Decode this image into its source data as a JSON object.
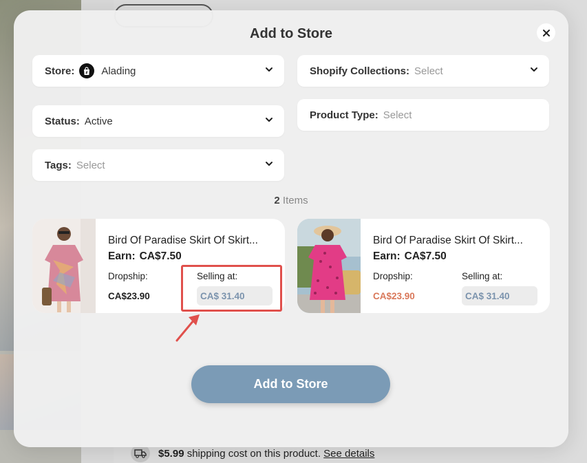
{
  "background": {
    "shipping": {
      "price": "$5.99",
      "text": " shipping cost on this product. ",
      "link": "See details"
    }
  },
  "modal": {
    "title": "Add to Store",
    "fields": {
      "store": {
        "label": "Store:",
        "value": "Alading"
      },
      "collections": {
        "label": "Shopify Collections:",
        "placeholder": "Select"
      },
      "status": {
        "label": "Status:",
        "value": "Active"
      },
      "product_type": {
        "label": "Product Type:",
        "placeholder": "Select"
      },
      "tags": {
        "label": "Tags:",
        "placeholder": "Select"
      }
    },
    "items": {
      "count": "2",
      "label": " Items"
    },
    "products": [
      {
        "title": "Bird Of Paradise Skirt Of Skirt...",
        "earn_label": "Earn:",
        "earn_value": "CA$7.50",
        "dropship_label": "Dropship:",
        "dropship_value": "CA$23.90",
        "dropship_color": "#222222",
        "selling_label": "Selling at:",
        "selling_value": "CA$ 31.40"
      },
      {
        "title": "Bird Of Paradise Skirt Of Skirt...",
        "earn_label": "Earn:",
        "earn_value": "CA$7.50",
        "dropship_label": "Dropship:",
        "dropship_value": "CA$23.90",
        "dropship_color": "#d9785a",
        "selling_label": "Selling at:",
        "selling_value": "CA$ 31.40"
      }
    ],
    "submit_label": "Add to Store"
  },
  "colors": {
    "accent_button": "#7b9bb6",
    "highlight": "#e0504c",
    "selling_text": "#7b93ad"
  },
  "icons": [
    "close-icon",
    "shopify-bag-icon",
    "chevron-down-icon",
    "truck-icon",
    "annotation-arrow-icon"
  ]
}
